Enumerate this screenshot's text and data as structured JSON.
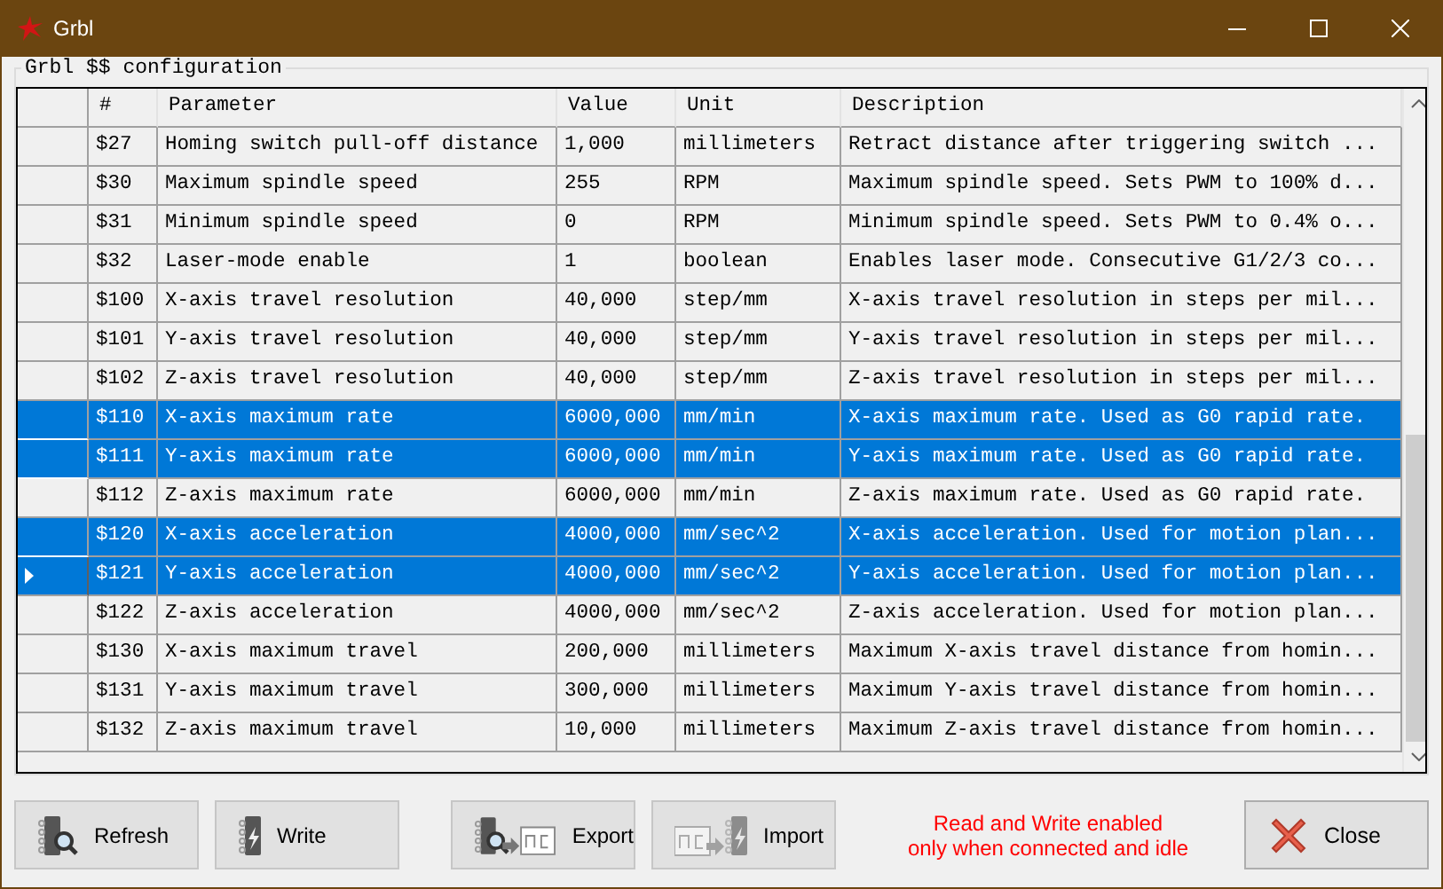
{
  "window": {
    "title": "Grbl"
  },
  "group": {
    "title": "Grbl $$ configuration"
  },
  "table": {
    "columns": [
      "#",
      "Parameter",
      "Value",
      "Unit",
      "Description"
    ],
    "rows": [
      {
        "cells": [
          "$27",
          "Homing switch pull-off distance",
          "1,000",
          "millimeters",
          "Retract distance after triggering switch ..."
        ],
        "selected": false,
        "current": false
      },
      {
        "cells": [
          "$30",
          "Maximum spindle speed",
          "255",
          "RPM",
          "Maximum spindle speed. Sets PWM to 100% d..."
        ],
        "selected": false,
        "current": false
      },
      {
        "cells": [
          "$31",
          "Minimum spindle speed",
          "0",
          "RPM",
          "Minimum spindle speed. Sets PWM to 0.4% o..."
        ],
        "selected": false,
        "current": false
      },
      {
        "cells": [
          "$32",
          "Laser-mode enable",
          "1",
          "boolean",
          "Enables laser mode. Consecutive G1/2/3 co..."
        ],
        "selected": false,
        "current": false
      },
      {
        "cells": [
          "$100",
          "X-axis travel resolution",
          "40,000",
          "step/mm",
          "X-axis travel resolution in steps per mil..."
        ],
        "selected": false,
        "current": false
      },
      {
        "cells": [
          "$101",
          "Y-axis travel resolution",
          "40,000",
          "step/mm",
          "Y-axis travel resolution in steps per mil..."
        ],
        "selected": false,
        "current": false
      },
      {
        "cells": [
          "$102",
          "Z-axis travel resolution",
          "40,000",
          "step/mm",
          "Z-axis travel resolution in steps per mil..."
        ],
        "selected": false,
        "current": false
      },
      {
        "cells": [
          "$110",
          "X-axis maximum rate",
          "6000,000",
          "mm/min",
          "X-axis maximum rate. Used as G0 rapid rate."
        ],
        "selected": true,
        "current": false
      },
      {
        "cells": [
          "$111",
          "Y-axis maximum rate",
          "6000,000",
          "mm/min",
          "Y-axis maximum rate. Used as G0 rapid rate."
        ],
        "selected": true,
        "current": false
      },
      {
        "cells": [
          "$112",
          "Z-axis maximum rate",
          "6000,000",
          "mm/min",
          "Z-axis maximum rate. Used as G0 rapid rate."
        ],
        "selected": false,
        "current": false
      },
      {
        "cells": [
          "$120",
          "X-axis acceleration",
          "4000,000",
          "mm/sec^2",
          "X-axis acceleration. Used for motion plan..."
        ],
        "selected": true,
        "current": false
      },
      {
        "cells": [
          "$121",
          "Y-axis acceleration",
          "4000,000",
          "mm/sec^2",
          "Y-axis acceleration. Used for motion plan..."
        ],
        "selected": true,
        "current": true
      },
      {
        "cells": [
          "$122",
          "Z-axis acceleration",
          "4000,000",
          "mm/sec^2",
          "Z-axis acceleration. Used for motion plan..."
        ],
        "selected": false,
        "current": false
      },
      {
        "cells": [
          "$130",
          "X-axis maximum travel",
          "200,000",
          "millimeters",
          "Maximum X-axis travel distance from homin..."
        ],
        "selected": false,
        "current": false
      },
      {
        "cells": [
          "$131",
          "Y-axis maximum travel",
          "300,000",
          "millimeters",
          "Maximum Y-axis travel distance from homin..."
        ],
        "selected": false,
        "current": false
      },
      {
        "cells": [
          "$132",
          "Z-axis maximum travel",
          "10,000",
          "millimeters",
          "Maximum Z-axis travel distance from homin..."
        ],
        "selected": false,
        "current": false
      }
    ]
  },
  "buttons": [
    {
      "label": "Refresh",
      "kind": "refresh"
    },
    {
      "label": "Write",
      "kind": "write"
    },
    {
      "label": "Export",
      "kind": "export"
    },
    {
      "label": "Import",
      "kind": "import"
    }
  ],
  "message": [
    "Read and Write enabled",
    "only when connected and idle"
  ],
  "close_button": {
    "label": "Close"
  }
}
